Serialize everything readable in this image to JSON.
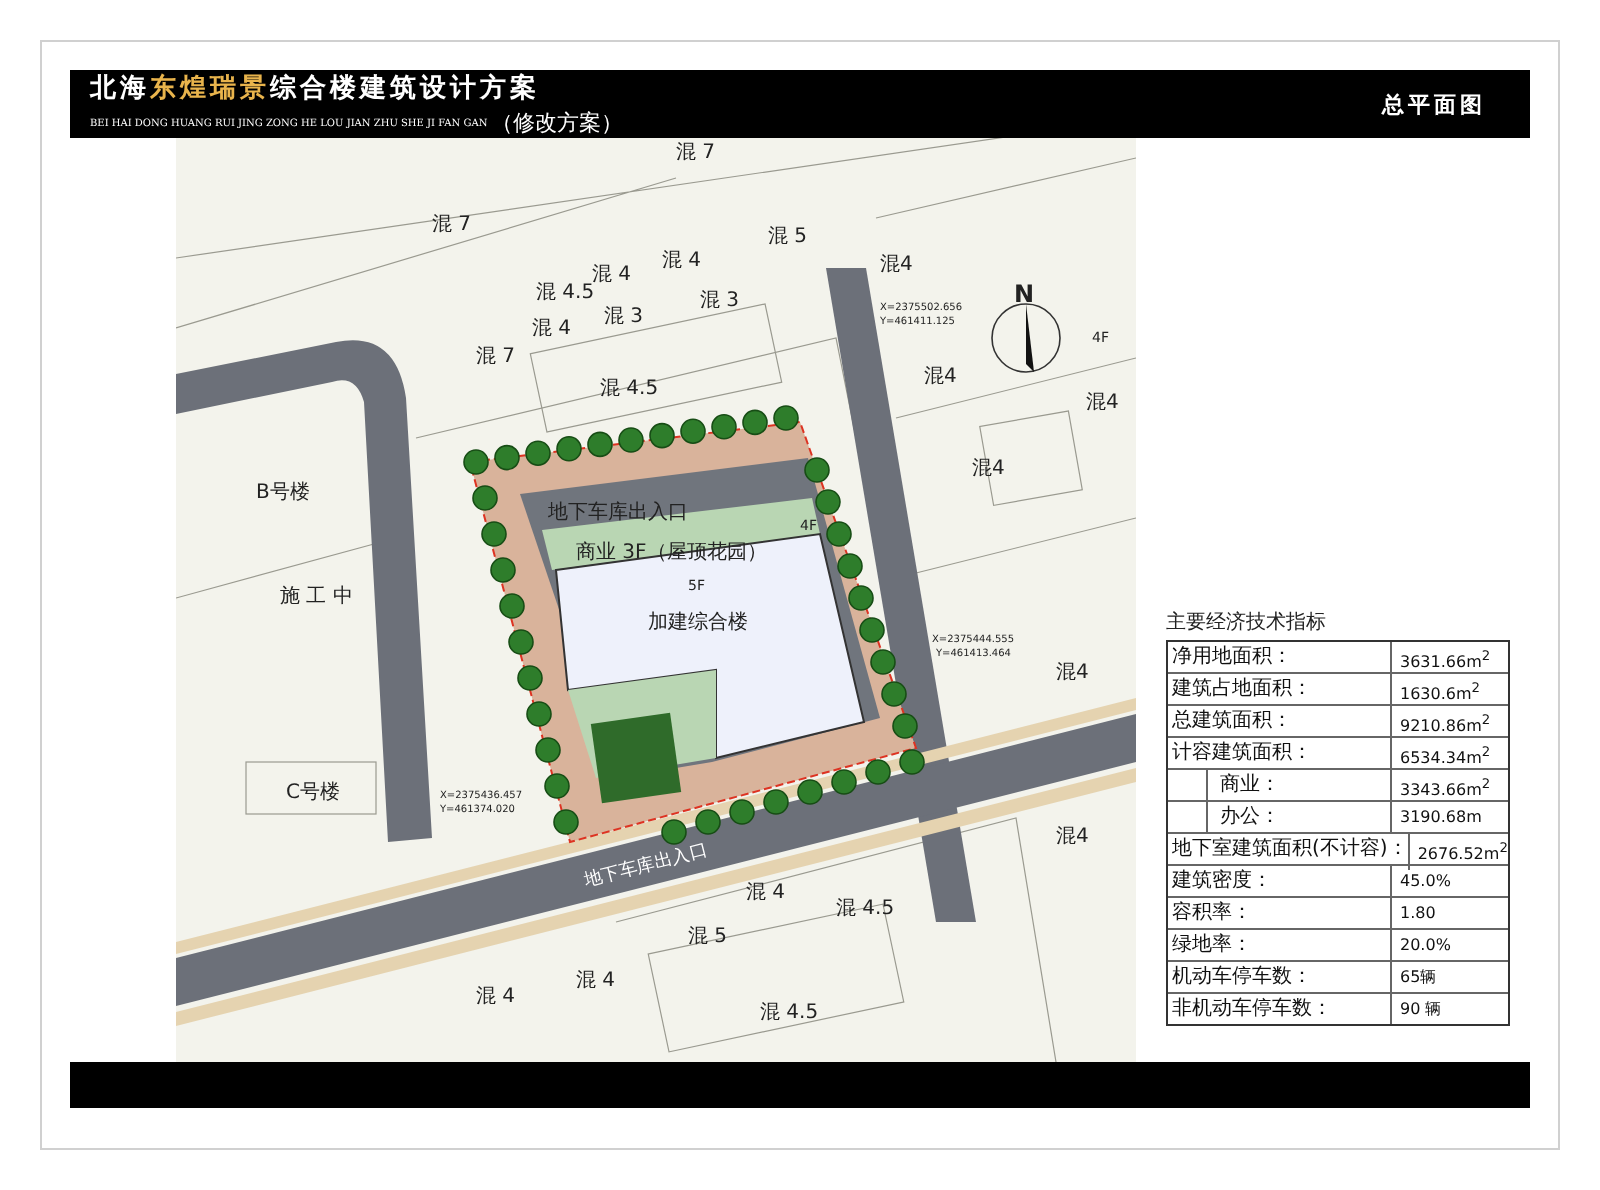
{
  "header": {
    "title_parts": [
      {
        "text": "北海",
        "highlight": false
      },
      {
        "text": "东煌瑞景",
        "highlight": true
      },
      {
        "text": "综合楼建筑设计方案",
        "highlight": false
      }
    ],
    "pinyin": "BEI HAI DONG HUANG RUI JING ZONG HE LOU JIAN ZHU SHE JI FAN GAN",
    "subtitle": "（修改方案）",
    "sheet_name": "总平面图"
  },
  "site_plan": {
    "labels": [
      {
        "text": "混 7",
        "kind": "building"
      },
      {
        "text": "混 7",
        "kind": "building"
      },
      {
        "text": "混 5",
        "kind": "building"
      },
      {
        "text": "混 4",
        "kind": "building"
      },
      {
        "text": "混4",
        "kind": "building"
      },
      {
        "text": "混 4",
        "kind": "building"
      },
      {
        "text": "混 4.5",
        "kind": "building"
      },
      {
        "text": "混 3",
        "kind": "building"
      },
      {
        "text": "N",
        "kind": "north"
      },
      {
        "text": "X=2375502.656",
        "kind": "coord"
      },
      {
        "text": "混 3",
        "kind": "building"
      },
      {
        "text": "混 4",
        "kind": "building"
      },
      {
        "text": "Y=461411.125",
        "kind": "coord"
      },
      {
        "text": "4F",
        "kind": "note"
      },
      {
        "text": "混 7",
        "kind": "building"
      },
      {
        "text": "混4",
        "kind": "building"
      },
      {
        "text": "混 4.5",
        "kind": "building"
      },
      {
        "text": "混4",
        "kind": "building"
      },
      {
        "text": "混4",
        "kind": "building"
      },
      {
        "text": "B号楼",
        "kind": "building"
      },
      {
        "text": "地下车库出入口",
        "kind": "building"
      },
      {
        "text": "4F",
        "kind": "note"
      },
      {
        "text": "商业 3F（屋顶花园）",
        "kind": "building"
      },
      {
        "text": "5F",
        "kind": "note"
      },
      {
        "text": "施 工 中",
        "kind": "building"
      },
      {
        "text": "加建综合楼",
        "kind": "building"
      },
      {
        "text": "X=2375444.555",
        "kind": "coord"
      },
      {
        "text": "Y=461413.464",
        "kind": "coord"
      },
      {
        "text": "混4",
        "kind": "building"
      },
      {
        "text": "C号楼",
        "kind": "building"
      },
      {
        "text": "X=2375436.457",
        "kind": "coord"
      },
      {
        "text": "Y=461374.020",
        "kind": "coord"
      },
      {
        "text": "混4",
        "kind": "building"
      },
      {
        "text": "地下车库出入口",
        "kind": "road"
      },
      {
        "text": "混 4",
        "kind": "building"
      },
      {
        "text": "混 4.5",
        "kind": "building"
      },
      {
        "text": "混 5",
        "kind": "building"
      },
      {
        "text": "混 4",
        "kind": "building"
      },
      {
        "text": "混 4",
        "kind": "building"
      },
      {
        "text": "混 4.5",
        "kind": "building"
      }
    ]
  },
  "indicators": {
    "caption": "主要经济技术指标",
    "rows": [
      {
        "label": "净用地面积：",
        "value": "3631.66m$^{2}$",
        "kind": "main"
      },
      {
        "label": "建筑占地面积：",
        "value": "1630.6m$^{2}$",
        "kind": "main"
      },
      {
        "label": "总建筑面积：",
        "value": "9210.86m$^{2}$",
        "kind": "main"
      },
      {
        "label": "计容建筑面积：",
        "value": "6534.34m$^{2}$",
        "kind": "main"
      },
      {
        "label": "商业：",
        "value": "3343.66m$^{2}$",
        "kind": "sub"
      },
      {
        "label": "办公：",
        "value": "3190.68m",
        "kind": "sub"
      },
      {
        "label": "地下室建筑面积(不计容)：",
        "value": "2676.52m$^{2}$",
        "kind": "main"
      },
      {
        "label": "建筑密度：",
        "value": "45.0%",
        "kind": "main"
      },
      {
        "label": "容积率：",
        "value": "1.80",
        "kind": "main"
      },
      {
        "label": "绿地率：",
        "value": "20.0%",
        "kind": "main"
      },
      {
        "label": "机动车停车数：",
        "value": "65辆",
        "kind": "main"
      },
      {
        "label": "非机动车停车数：",
        "value": "90 辆",
        "kind": "main"
      }
    ]
  }
}
